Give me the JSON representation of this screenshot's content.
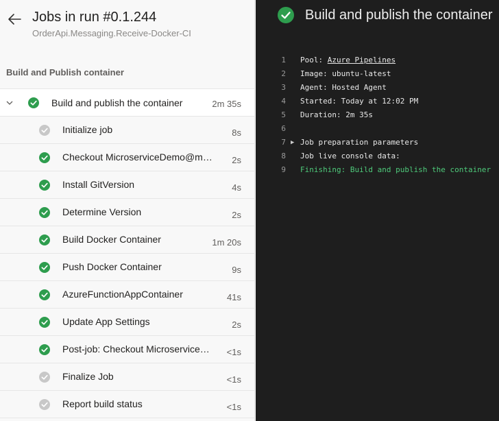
{
  "header": {
    "title": "Jobs in run #0.1.244",
    "pipeline": "OrderApi.Messaging.Receive-Docker-CI"
  },
  "stage": {
    "name": "Build and Publish container"
  },
  "job": {
    "name": "Build and publish the container",
    "duration": "2m 35s",
    "status": "success"
  },
  "steps": [
    {
      "name": "Initialize job",
      "duration": "8s",
      "status": "skipped"
    },
    {
      "name": "Checkout MicroserviceDemo@master to s",
      "duration": "2s",
      "status": "success"
    },
    {
      "name": "Install GitVersion",
      "duration": "4s",
      "status": "success"
    },
    {
      "name": "Determine Version",
      "duration": "2s",
      "status": "success"
    },
    {
      "name": "Build Docker Container",
      "duration": "1m 20s",
      "status": "success"
    },
    {
      "name": "Push Docker Container",
      "duration": "9s",
      "status": "success"
    },
    {
      "name": "AzureFunctionAppContainer",
      "duration": "41s",
      "status": "success"
    },
    {
      "name": "Update App Settings",
      "duration": "2s",
      "status": "success"
    },
    {
      "name": "Post-job: Checkout MicroserviceDemo@master",
      "duration": "<1s",
      "status": "success"
    },
    {
      "name": "Finalize Job",
      "duration": "<1s",
      "status": "skipped"
    },
    {
      "name": "Report build status",
      "duration": "<1s",
      "status": "skipped"
    }
  ],
  "log": {
    "title": "Build and publish the container",
    "lines": [
      {
        "n": "1",
        "prefix": "Pool: ",
        "link": "Azure Pipelines"
      },
      {
        "n": "2",
        "text": "Image: ubuntu-latest"
      },
      {
        "n": "3",
        "text": "Agent: Hosted Agent"
      },
      {
        "n": "4",
        "text": "Started: Today at 12:02 PM"
      },
      {
        "n": "5",
        "text": "Duration: 2m 35s"
      },
      {
        "n": "6",
        "text": ""
      },
      {
        "n": "7",
        "text": "Job preparation parameters",
        "expandable": true
      },
      {
        "n": "8",
        "text": "Job live console data:"
      },
      {
        "n": "9",
        "text": "Finishing: Build and publish the container",
        "style": "green"
      }
    ]
  },
  "colors": {
    "success": "#2e9d4e",
    "skipped": "#c8c8c8",
    "log_background": "#1e1e1e",
    "log_success_text": "#4ec97a"
  },
  "icons": {
    "back": "arrow-left-icon",
    "expand": "chevron-down-icon",
    "success": "check-circle-icon",
    "skipped": "skipped-circle-icon",
    "collapsed": "triangle-right-icon"
  }
}
